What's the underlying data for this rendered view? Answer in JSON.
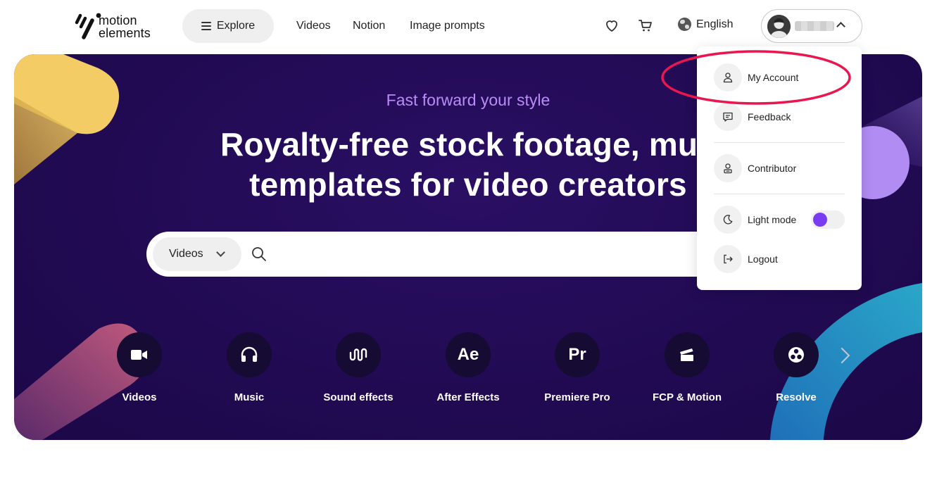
{
  "header": {
    "logo": {
      "line1": "motion",
      "line2": "elements"
    },
    "explore_label": "Explore",
    "nav": [
      "Videos",
      "Notion",
      "Image prompts"
    ],
    "language": "English",
    "username": ""
  },
  "hero": {
    "tagline": "Fast forward your style",
    "headline_line1": "Royalty-free stock footage, mus",
    "headline_line2": "templates for video creators",
    "search": {
      "type": "Videos",
      "placeholder": ""
    },
    "categories": [
      {
        "label": "Videos",
        "icon": "video-camera-icon"
      },
      {
        "label": "Music",
        "icon": "headphones-icon"
      },
      {
        "label": "Sound effects",
        "icon": "sound-wave-icon"
      },
      {
        "label": "After Effects",
        "icon_text": "Ae"
      },
      {
        "label": "Premiere Pro",
        "icon_text": "Pr"
      },
      {
        "label": "FCP & Motion",
        "icon": "clapperboard-icon"
      },
      {
        "label": "Resolve",
        "icon": "resolve-icon"
      }
    ]
  },
  "account_menu": {
    "items": [
      {
        "label": "My Account",
        "icon": "user-icon"
      },
      {
        "label": "Feedback",
        "icon": "chat-icon"
      },
      {
        "label": "Contributor",
        "icon": "contributor-icon"
      },
      {
        "label": "Light mode",
        "icon": "moon-icon",
        "toggle": true
      },
      {
        "label": "Logout",
        "icon": "logout-icon"
      }
    ]
  },
  "colors": {
    "hero_bg": "#210a52",
    "tagline": "#b98cf6",
    "toggle_knob": "#7a3cf2",
    "annotation": "#e8174f"
  }
}
